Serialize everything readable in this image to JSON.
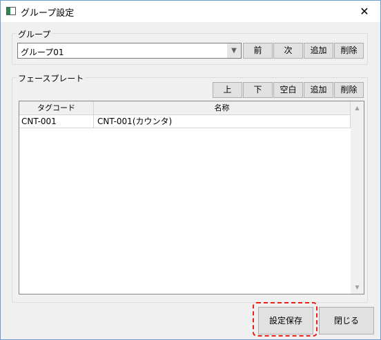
{
  "window": {
    "title": "グループ設定",
    "close_glyph": "✕"
  },
  "group_box": {
    "legend": "グループ",
    "combo_value": "グループ01",
    "buttons": {
      "prev": "前",
      "next": "次",
      "add": "追加",
      "delete": "削除"
    }
  },
  "faceplate_box": {
    "legend": "フェースプレート",
    "buttons": {
      "up": "上",
      "down": "下",
      "blank": "空白",
      "add": "追加",
      "delete": "削除"
    },
    "table": {
      "columns": [
        "タグコード",
        "名称"
      ],
      "rows": [
        [
          "CNT-001",
          "CNT-001(カウンタ)"
        ]
      ]
    }
  },
  "footer": {
    "save": "設定保存",
    "close": "閉じる"
  },
  "colors": {
    "highlight": "#e8201a",
    "window_border": "#6b9bd1"
  }
}
